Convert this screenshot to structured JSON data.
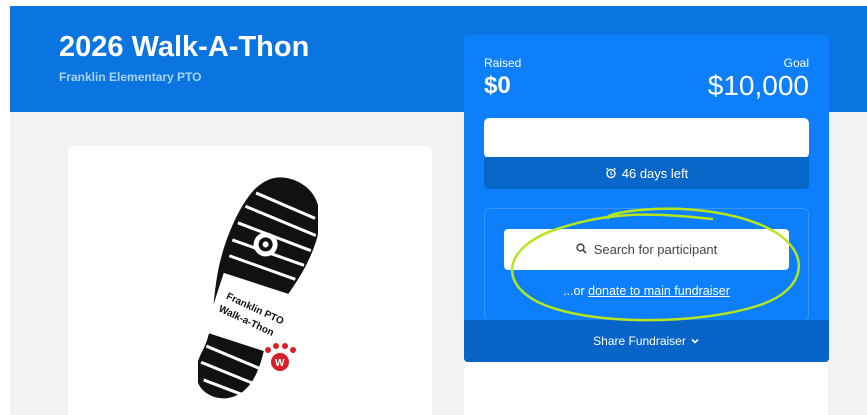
{
  "header": {
    "title": "2026 Walk-A-Thon",
    "organization": "Franklin Elementary PTO"
  },
  "logo": {
    "icon": "shoe-print-icon",
    "text_lines": [
      "Franklin PTO",
      "Walk-a-Thon"
    ],
    "badge_letter": "W"
  },
  "fundraiser": {
    "raised_label": "Raised",
    "raised_amount": "$0",
    "goal_label": "Goal",
    "goal_amount": "$10,000",
    "progress_fraction": 0,
    "days_left": "46 days left",
    "search_placeholder": "Search for participant",
    "or_prefix": "...or ",
    "donate_link": "donate to main fundraiser",
    "share_label": "Share Fundraiser"
  },
  "colors": {
    "header_bg": "#0a74e0",
    "panel_bg": "#0d7ffa",
    "panel_dark": "#0866c8",
    "annotation": "#b5e61d"
  }
}
